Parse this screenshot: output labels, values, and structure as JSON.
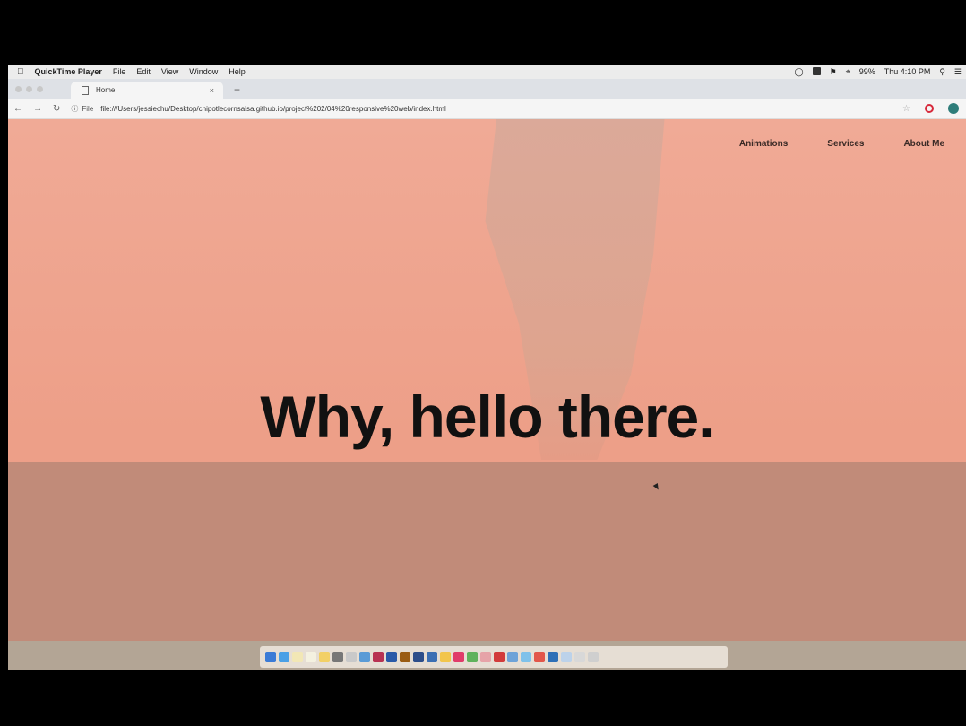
{
  "menubar": {
    "app_name": "QuickTime Player",
    "menus": [
      "File",
      "Edit",
      "View",
      "Window",
      "Help"
    ],
    "battery": "99%",
    "clock": "Thu 4:10 PM"
  },
  "browser": {
    "tab_title": "Home",
    "tab_close": "×",
    "new_tab": "+",
    "url_scheme": "File",
    "url": "file:///Users/jessiechu/Desktop/chipotlecornsalsa.github.io/project%202/04%20responsive%20web/index.html"
  },
  "page": {
    "nav": [
      "Animations",
      "Services",
      "About Me"
    ],
    "hero_text": "Why, hello there."
  },
  "colors": {
    "page_bg": "#f0aa96",
    "floor": "#c18b79",
    "hero_text": "#111111"
  }
}
